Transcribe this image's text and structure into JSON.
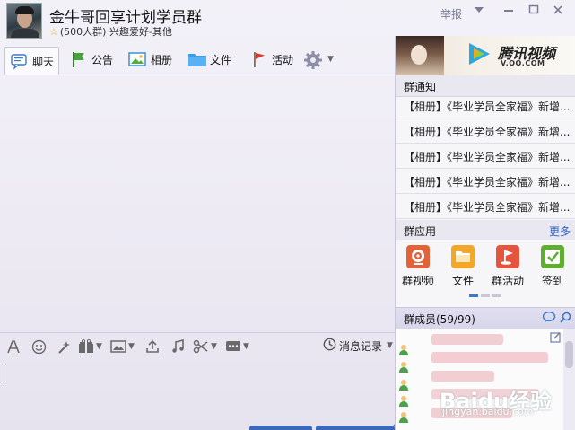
{
  "header": {
    "group_name": "金牛哥回享计划学员群",
    "group_info": "(500人群) 兴趣爱好-其他",
    "report_label": "举报"
  },
  "tabs": [
    {
      "label": "聊天",
      "icon": "chat-icon",
      "active": true
    },
    {
      "label": "公告",
      "icon": "announcement-flag-icon"
    },
    {
      "label": "相册",
      "icon": "photo-album-icon"
    },
    {
      "label": "文件",
      "icon": "folder-icon"
    },
    {
      "label": "活动",
      "icon": "activity-flag-icon"
    }
  ],
  "input_toolbar": {
    "history_label": "消息记录"
  },
  "ad": {
    "brand": "腾讯视频",
    "url": "V.QQ.COM"
  },
  "notices": {
    "title": "群通知",
    "items": [
      "【相册】《毕业学员全家福》新增...",
      "【相册】《毕业学员全家福》新增...",
      "【相册】《毕业学员全家福》新增...",
      "【相册】《毕业学员全家福》新增...",
      "【相册】《毕业学员全家福》新增..."
    ]
  },
  "apps": {
    "title": "群应用",
    "more_label": "更多",
    "items": [
      {
        "label": "群视频",
        "icon": "video-camera-icon",
        "color": "#e4623a"
      },
      {
        "label": "文件",
        "icon": "folder-icon",
        "color": "#f2a62a"
      },
      {
        "label": "群活动",
        "icon": "activity-flag-icon",
        "color": "#e5553e"
      },
      {
        "label": "签到",
        "icon": "checkin-icon",
        "color": "#5fae2f"
      }
    ]
  },
  "members": {
    "title": "群成员(59/99)"
  },
  "watermark": {
    "text": "Baidu经验",
    "url": "jingyan.baidu.com"
  },
  "colors": {
    "accent_blue": "#2e63c7",
    "send_bar": "#3d67b8",
    "background": "#ece9f3"
  }
}
